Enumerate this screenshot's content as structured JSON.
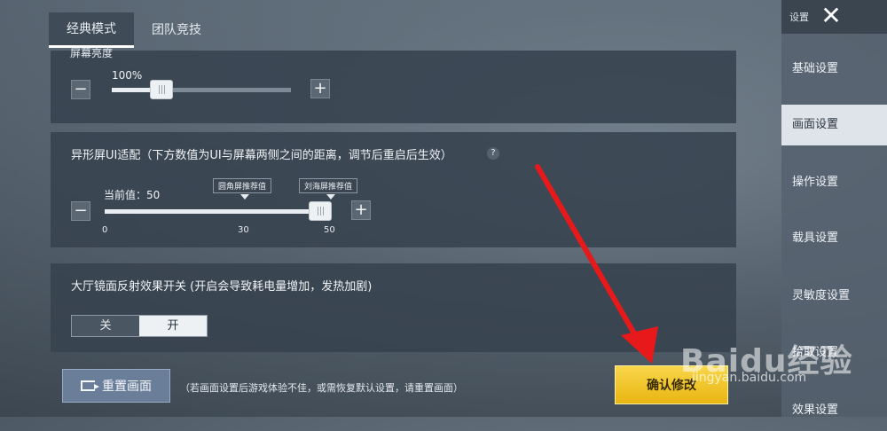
{
  "tabs": [
    {
      "label": "经典模式",
      "active": true
    },
    {
      "label": "团队竞技",
      "active": false
    }
  ],
  "brightness": {
    "partial_title": "屏幕亮度",
    "value_label": "100%",
    "minus": "−",
    "plus": "+",
    "level_percent": 100
  },
  "ui_adapt": {
    "title": "异形屏UI适配（下方数值为UI与屏幕两侧之间的距离，调节后重启后生效）",
    "help": "?",
    "current_value": "当前值：50",
    "callout_round": "圆角屏推荐值",
    "callout_notch": "刘海屏推荐值",
    "ticks": [
      "0",
      "30",
      "50"
    ],
    "minus": "−",
    "plus": "+",
    "value": 50,
    "min": 0,
    "max": 50
  },
  "reflection": {
    "title": "大厅镜面反射效果开关 (开启会导致耗电量增加，发热加剧)",
    "off_label": "关",
    "on_label": "开",
    "selected": "开"
  },
  "bottom": {
    "reset_label": "重置画面",
    "reset_note": "（若画面设置后游戏体验不佳，或需恢复默认设置，请重置画面）",
    "confirm_label": "确认修改"
  },
  "sidebar": {
    "header": "设置",
    "close": "✕",
    "items": [
      {
        "label": "基础设置",
        "active": false
      },
      {
        "label": "画面设置",
        "active": true
      },
      {
        "label": "操作设置",
        "active": false
      },
      {
        "label": "载具设置",
        "active": false
      },
      {
        "label": "灵敏度设置",
        "active": false
      },
      {
        "label": "拾取设置",
        "active": false
      },
      {
        "label": "效果设置",
        "active": false
      }
    ]
  },
  "overlay": {
    "watermark": "Baidu经验",
    "watermark_url": "jingyan.baidu.com",
    "arrow_color": "#e8191a"
  },
  "colors": {
    "confirm": "#f2c525",
    "active_tab_underline": "#ffffff"
  }
}
